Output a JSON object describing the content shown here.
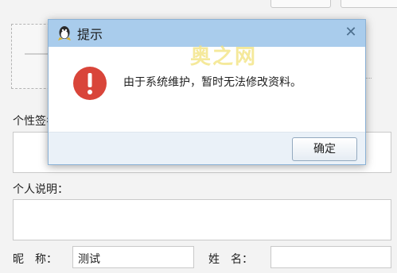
{
  "form": {
    "signature_label": "个性签名：",
    "description_label": "个人说明：",
    "nickname_label": "昵　称：",
    "nickname_value": "测试",
    "name_label": "姓　名：",
    "name_value": ""
  },
  "dialog": {
    "title": "提示",
    "icon": "qq-penguin-icon",
    "watermark": "奥之网",
    "message": "由于系统维护，暂时无法修改资料。",
    "ok_label": "确定",
    "close_glyph": "✕",
    "colors": {
      "titlebar": "#a9ccec",
      "warning": "#d9453a"
    }
  }
}
